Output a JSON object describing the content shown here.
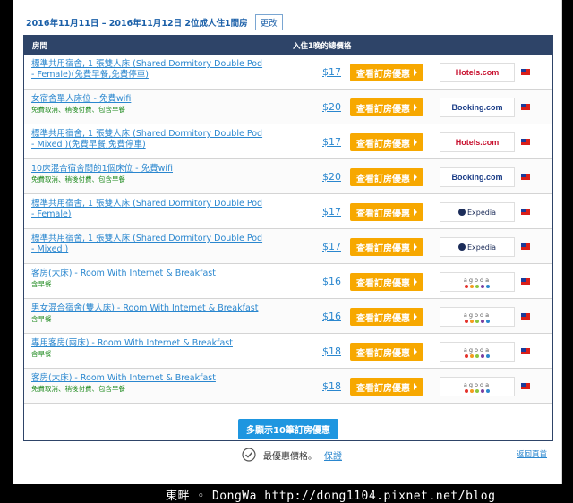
{
  "header": {
    "date_range": "2016年11月11日 – 2016年11月12日 2位成人住1間房",
    "change_label": "更改"
  },
  "table": {
    "col_room": "房間",
    "col_price": "入住1晚的總價格",
    "deal_label": "查看訂房優惠",
    "rows": [
      {
        "name": "標準共用宿舍, 1 張雙人床 (Shared Dormitory Double Pod - Female)(免費早餐,免費停車)",
        "note": "",
        "price": "$17",
        "vendor": "Hotels.com"
      },
      {
        "name": "女宿舍單人床位 - 免費wifi",
        "note": "免費取消、稍後付費、包含早餐",
        "price": "$20",
        "vendor": "Booking.com"
      },
      {
        "name": "標準共用宿舍, 1 張雙人床 (Shared Dormitory Double Pod - Mixed )(免費早餐,免費停車)",
        "note": "",
        "price": "$17",
        "vendor": "Hotels.com"
      },
      {
        "name": "10床混合宿舍間的1個床位 - 免費wifi",
        "note": "免費取消、稍後付費、包含早餐",
        "price": "$20",
        "vendor": "Booking.com"
      },
      {
        "name": "標準共用宿舍, 1 張雙人床 (Shared Dormitory Double Pod - Female)",
        "note": "",
        "price": "$17",
        "vendor": "Expedia"
      },
      {
        "name": "標準共用宿舍, 1 張雙人床 (Shared Dormitory Double Pod - Mixed )",
        "note": "",
        "price": "$17",
        "vendor": "Expedia"
      },
      {
        "name": "客房(大床) - Room With Internet & Breakfast",
        "note": "含早餐",
        "price": "$16",
        "vendor": "agoda"
      },
      {
        "name": "男女混合宿舍(雙人床) - Room With Internet & Breakfast",
        "note": "含早餐",
        "price": "$16",
        "vendor": "agoda"
      },
      {
        "name": "專用客房(兩床) - Room With Internet & Breakfast",
        "note": "含早餐",
        "price": "$18",
        "vendor": "agoda"
      },
      {
        "name": "客房(大床) - Room With Internet & Breakfast",
        "note": "免費取消、稍後付費、包含早餐",
        "price": "$18",
        "vendor": "agoda"
      }
    ],
    "more_label": "多顯示10筆訂房優惠"
  },
  "footer": {
    "best_price": "最優惠價格。",
    "guarantee": "保證",
    "back_top": "返回頁首"
  },
  "watermark": "東畔 ◦ DongWa http://dong1104.pixnet.net/blog",
  "colors": {
    "header_bg": "#2e4468",
    "deal_btn": "#f7a800",
    "link": "#2a87cf",
    "more_btn": "#1e96e0"
  },
  "icons": {
    "check": "check-circle-icon",
    "flag": "taiwan-flag-icon"
  }
}
